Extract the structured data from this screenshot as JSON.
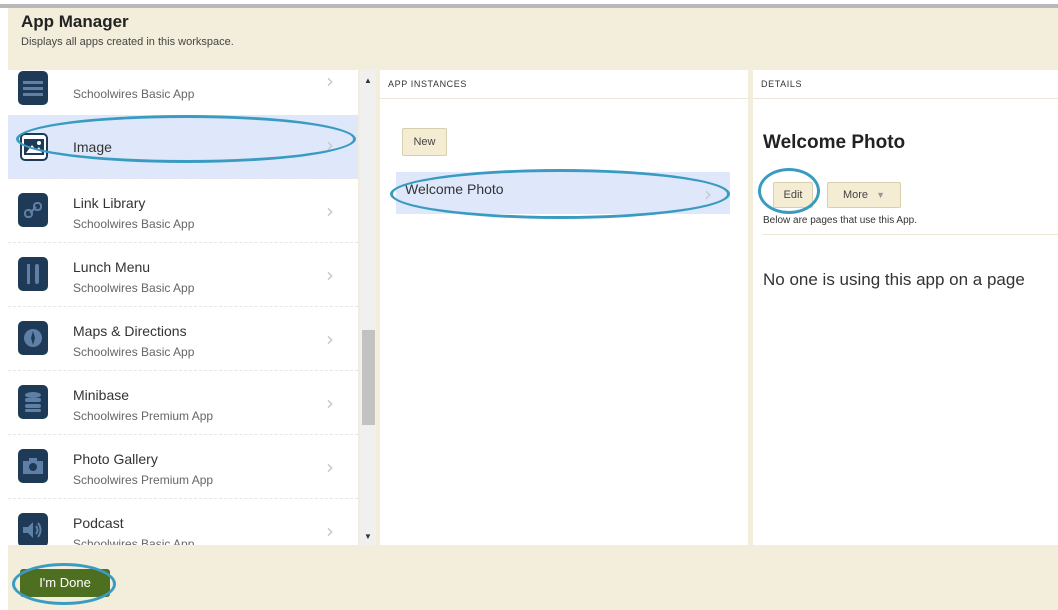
{
  "header": {
    "title": "App Manager",
    "subtitle": "Displays all apps created in this workspace."
  },
  "apps": [
    {
      "name": "",
      "type": "Schoolwires Basic App",
      "icon": "list-icon"
    },
    {
      "name": "Image",
      "type": "",
      "icon": "image-icon"
    },
    {
      "name": "Link Library",
      "type": "Schoolwires Basic App",
      "icon": "link-icon"
    },
    {
      "name": "Lunch Menu",
      "type": "Schoolwires Basic App",
      "icon": "utensils-icon"
    },
    {
      "name": "Maps & Directions",
      "type": "Schoolwires Basic App",
      "icon": "compass-icon"
    },
    {
      "name": "Minibase",
      "type": "Schoolwires Premium App",
      "icon": "database-icon"
    },
    {
      "name": "Photo Gallery",
      "type": "Schoolwires Premium App",
      "icon": "camera-icon"
    },
    {
      "name": "Podcast",
      "type": "Schoolwires Basic App",
      "icon": "speaker-icon"
    }
  ],
  "instances": {
    "header": "APP INSTANCES",
    "new_label": "New",
    "items": [
      "Welcome Photo"
    ]
  },
  "details": {
    "header": "DETAILS",
    "title": "Welcome Photo",
    "edit_label": "Edit",
    "more_label": "More",
    "note": "Below are pages that use this App.",
    "empty_message": "No one is using this app on a page"
  },
  "footer": {
    "done_label": "I'm Done"
  },
  "colors": {
    "panel_bg": "#f3eedb",
    "selected": "#dfe8fb",
    "highlight_oval": "#3a9bc2",
    "done_button": "#4d6f1f"
  }
}
